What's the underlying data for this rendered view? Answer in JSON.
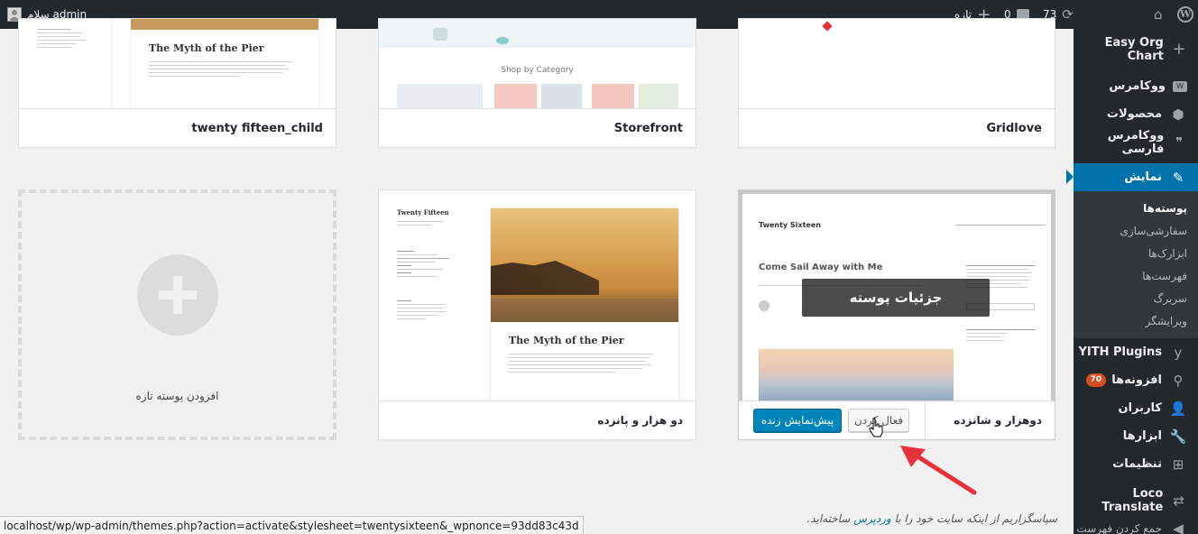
{
  "adminbar": {
    "greeting": "سلام admin",
    "new_label": "تازه",
    "comments_count": "0",
    "updates_count": "73"
  },
  "menu": {
    "items_top": [
      {
        "label": "Easy Org Chart",
        "icon": "plus-icon"
      },
      {
        "label": "ووکامرس",
        "icon": "woo-icon"
      },
      {
        "label": "محصولات",
        "icon": "box-icon"
      },
      {
        "label": "ووکامرس فارسی",
        "icon": "quote-icon"
      }
    ],
    "current": {
      "label": "نمایش",
      "icon": "brush-icon"
    },
    "submenu": [
      "پوسته‌ها",
      "سفارشی‌سازی",
      "ابزارک‌ها",
      "فهرست‌ها",
      "سربرگ",
      "ویرایشگر"
    ],
    "items_bottom": [
      {
        "label": "YITH Plugins",
        "icon": "yith-icon"
      },
      {
        "label": "افزونه‌ها",
        "icon": "plugin-icon",
        "badge": "70"
      },
      {
        "label": "کاربران",
        "icon": "user-icon"
      },
      {
        "label": "ابزارها",
        "icon": "wrench-icon"
      },
      {
        "label": "تنظیمات",
        "icon": "settings-icon"
      },
      {
        "label": "Loco Translate",
        "icon": "translate-icon"
      },
      {
        "label": "جمع کردن فهرست",
        "icon": "collapse-icon"
      }
    ]
  },
  "themes": {
    "row1": [
      {
        "name": "twenty fifteen_child"
      },
      {
        "name": "Storefront",
        "shot_caption": "Shop by Category"
      },
      {
        "name": "Gridlove"
      }
    ],
    "add_new_label": "افزودن پوسته تازه",
    "twentyfifteen": {
      "name": "دو هزار و پانزده",
      "site_title": "Twenty Fifteen",
      "post_title": "The Myth of the Pier"
    },
    "twentysixteen": {
      "name": "دوهزار و شانزده",
      "site_title": "Twenty Sixteen",
      "post_title": "Come Sail Away with Me",
      "details_label": "جزئیات پوسته",
      "activate_label": "فعال کردن",
      "preview_label": "پیش‌نمایش زنده"
    },
    "row1_post_title": "The Myth of the Pier"
  },
  "footer": {
    "thanks_prefix": "سپاسگزاریم از اینکه سایت خود را با",
    "wordpress_link": "وردپرس",
    "thanks_suffix": "ساخته‌اید."
  },
  "statusbar": {
    "url": "localhost/wp/wp-admin/themes.php?action=activate&stylesheet=twentysixteen&_wpnonce=93dd83c43d"
  },
  "colors": {
    "adminbar_bg": "#23282d",
    "menu_current": "#0073aa",
    "primary_button": "#0085ba",
    "arrow": "#e8313a"
  }
}
